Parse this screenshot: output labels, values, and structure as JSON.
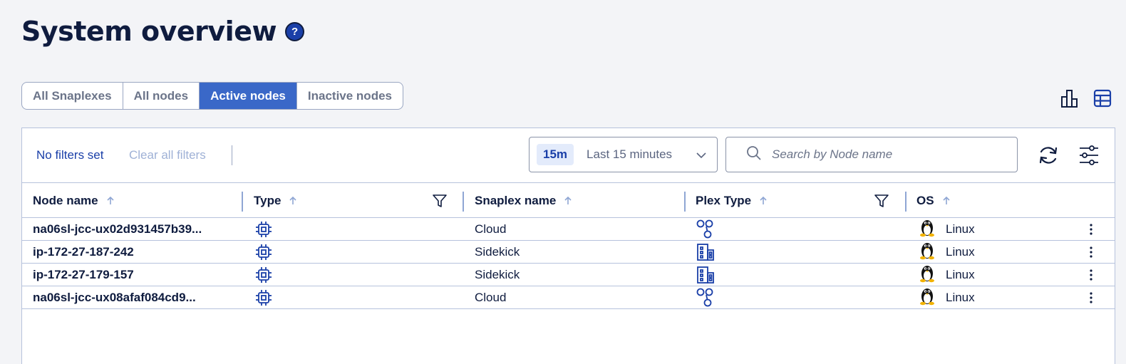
{
  "page": {
    "title": "System overview",
    "help_icon": "question-circle-icon"
  },
  "tabs": [
    {
      "label": "All Snaplexes",
      "active": false
    },
    {
      "label": "All nodes",
      "active": false
    },
    {
      "label": "Active nodes",
      "active": true
    },
    {
      "label": "Inactive nodes",
      "active": false
    }
  ],
  "view_toggle": {
    "chart_icon": "bar-chart-icon",
    "table_icon": "table-grid-icon"
  },
  "filters": {
    "status": "No filters set",
    "clear_label": "Clear all filters"
  },
  "time_range": {
    "badge": "15m",
    "label": "Last 15 minutes"
  },
  "search": {
    "placeholder": "Search by Node name",
    "value": ""
  },
  "columns": [
    {
      "label": "Node name",
      "filterable": false
    },
    {
      "label": "Type",
      "filterable": true
    },
    {
      "label": "Snaplex name",
      "filterable": false
    },
    {
      "label": "Plex Type",
      "filterable": true
    },
    {
      "label": "OS",
      "filterable": false
    }
  ],
  "rows": [
    {
      "node_name": "na06sl-jcc-ux02d931457b39...",
      "type_icon": "cpu-chip-icon",
      "snaplex": "Cloud",
      "plex_icon": "cloud-nodes-icon",
      "os_icon": "linux-tux-icon",
      "os": "Linux"
    },
    {
      "node_name": "ip-172-27-187-242",
      "type_icon": "cpu-chip-icon",
      "snaplex": "Sidekick",
      "plex_icon": "building-icon",
      "os_icon": "linux-tux-icon",
      "os": "Linux"
    },
    {
      "node_name": "ip-172-27-179-157",
      "type_icon": "cpu-chip-icon",
      "snaplex": "Sidekick",
      "plex_icon": "building-icon",
      "os_icon": "linux-tux-icon",
      "os": "Linux"
    },
    {
      "node_name": "na06sl-jcc-ux08afaf084cd9...",
      "type_icon": "cpu-chip-icon",
      "snaplex": "Cloud",
      "plex_icon": "cloud-nodes-icon",
      "os_icon": "linux-tux-icon",
      "os": "Linux"
    }
  ],
  "colors": {
    "accent": "#3a68c8",
    "title": "#0f1c3f",
    "link": "#1a3fa8",
    "border": "#b6c2dc"
  }
}
